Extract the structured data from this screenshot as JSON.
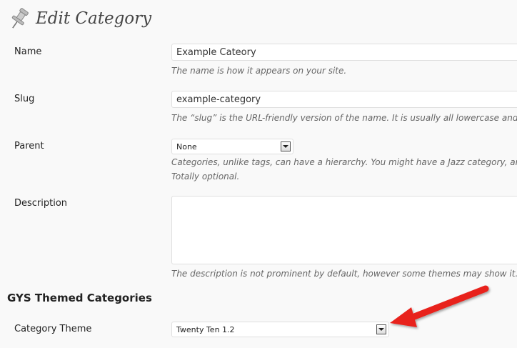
{
  "header": {
    "title": "Edit Category",
    "icon": "pushpin-icon"
  },
  "form": {
    "name": {
      "label": "Name",
      "value": "Example Cateory",
      "hint": "The name is how it appears on your site."
    },
    "slug": {
      "label": "Slug",
      "value": "example-category",
      "hint": "The “slug” is the URL-friendly version of the name. It is usually all lowercase and"
    },
    "parent": {
      "label": "Parent",
      "selected": "None",
      "hint_line1": "Categories, unlike tags, can have a hierarchy. You might have a Jazz category, an",
      "hint_line2": "Totally optional."
    },
    "description": {
      "label": "Description",
      "value": "",
      "hint": "The description is not prominent by default, however some themes may show it."
    }
  },
  "gys": {
    "section_title": "GYS Themed Categories",
    "theme": {
      "label": "Category Theme",
      "selected": "Twenty Ten 1.2"
    }
  },
  "annotation": {
    "arrow_color": "#e8201c"
  }
}
